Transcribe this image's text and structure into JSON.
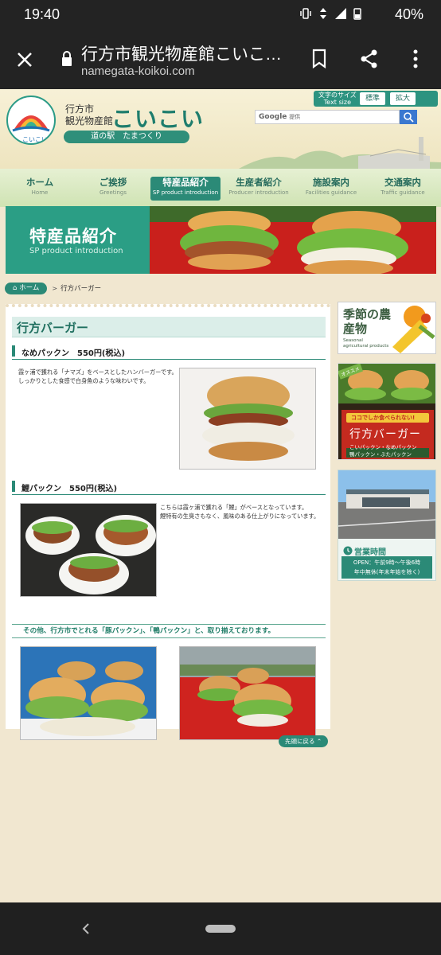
{
  "status": {
    "time": "19:40",
    "battery": "40%"
  },
  "browser": {
    "title": "行方市観光物産館こいこ…",
    "host": "namegata-koikoi.com"
  },
  "header": {
    "logo_text": "こいこい",
    "site_line1": "行方市",
    "site_line2": "観光物産館",
    "site_big": "こいこい",
    "tag": "道の駅　たまつくり",
    "textsize_label1": "文字のサイズ",
    "textsize_label2": "Text size",
    "size_normal": "標準",
    "size_large": "拡大",
    "search_brand": "Google",
    "search_placeholder": "提供"
  },
  "nav": [
    {
      "jp": "ホーム",
      "en": "Home"
    },
    {
      "jp": "ご挨拶",
      "en": "Greetings"
    },
    {
      "jp": "特産品紹介",
      "en": "SP product introduction"
    },
    {
      "jp": "生産者紹介",
      "en": "Producer introduction"
    },
    {
      "jp": "施設案内",
      "en": "Facilities guidance"
    },
    {
      "jp": "交通案内",
      "en": "Traffic guidance"
    }
  ],
  "banner": {
    "jp": "特産品紹介",
    "en": "SP product introduction"
  },
  "breadcrumb": {
    "home": "ホーム",
    "sep": ">",
    "current": "行方バーガー"
  },
  "main": {
    "title": "行方バーガー",
    "section1": {
      "heading": "なめパックン　550円(税込)",
      "text1": "霞ヶ浦で獲れる「ナマズ」をベースとしたハンバーガーです。",
      "text2": "しっかりとした食感で白身魚のような味わいです。"
    },
    "section2": {
      "heading": "鯉パックン　550円(税込)",
      "text1": "こちらは霞ヶ浦で獲れる「鯉」がベースとなっています。",
      "text2": "鯉特有の生臭さもなく、風味のある仕上がりになっています。"
    },
    "others": "その他、行方市でとれる「豚パックン」、「鴨パックン」と、取り揃えております。",
    "to_top": "先頭に戻る"
  },
  "sidebar": {
    "season_title": "季節の農産物",
    "season_en1": "Seasonal",
    "season_en2": "agricultural products",
    "burger_badge": "オススメ",
    "burger_tagline": "ココでしか食べられない!",
    "burger_title": "行方バーガー",
    "burger_items1": "こいパックン・なめパックン",
    "burger_items2": "鴨パックン・ぶたパックン",
    "hours_title": "営業時間",
    "hours_line1": "OPEN：午前9時～午後6時",
    "hours_line2": "年中無休(年末年始を除く)"
  },
  "colors": {
    "accent": "#2b8a77",
    "background": "#f1e7d0"
  }
}
